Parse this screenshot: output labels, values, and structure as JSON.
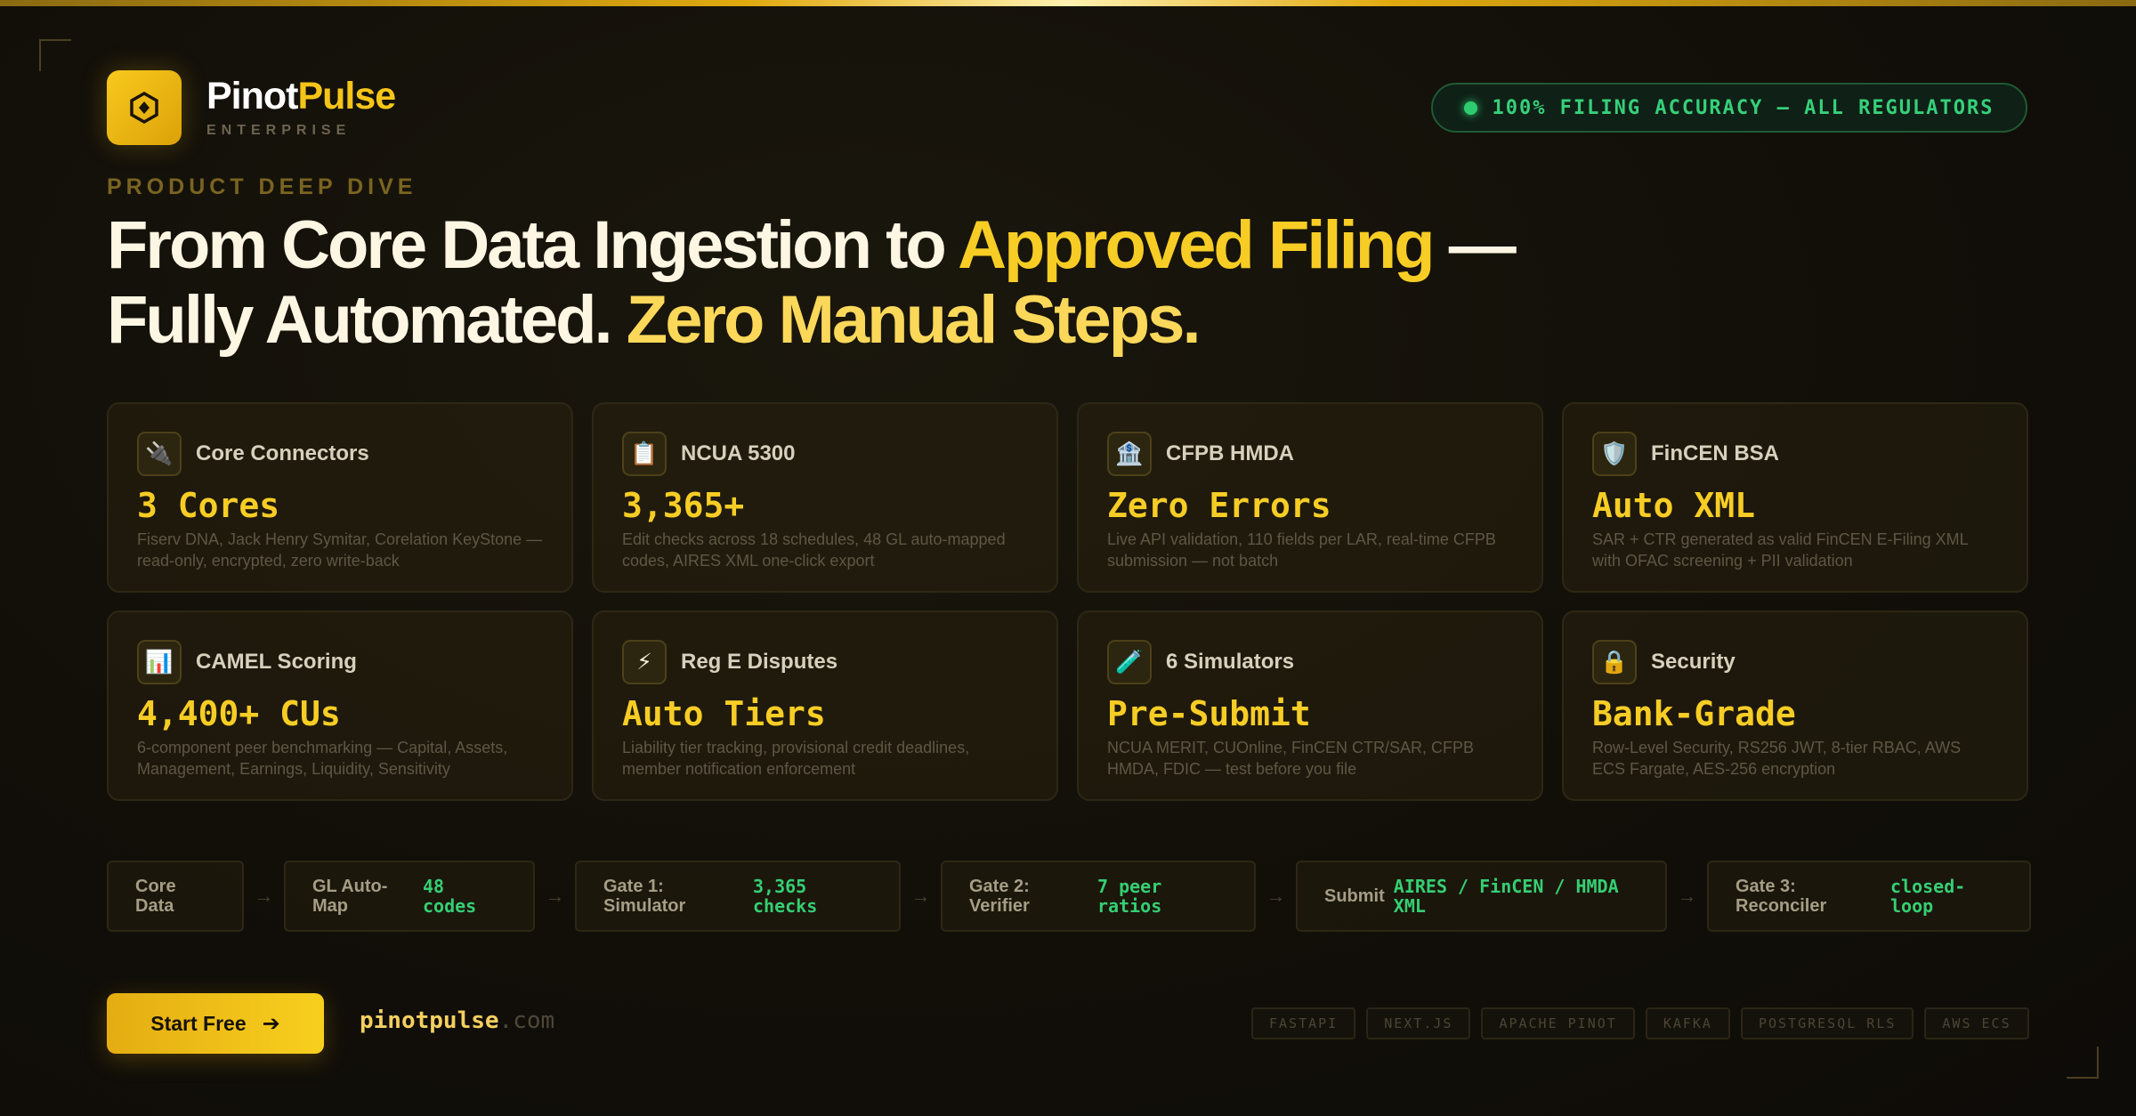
{
  "brand": {
    "name_part1": "Pinot",
    "name_part2": "Pulse",
    "tier": "ENTERPRISE"
  },
  "status_badge": {
    "text": "100% FILING ACCURACY — ALL REGULATORS",
    "color": "#2ecc71"
  },
  "hero": {
    "eyebrow": "PRODUCT DEEP DIVE",
    "line1_a": "From Core Data Ingestion to ",
    "line1_highlight": "Approved Filing",
    "line1_b": " —",
    "line2_a": "Fully Automated. ",
    "line2_highlight": "Zero Manual Steps."
  },
  "cards": [
    {
      "icon": "plug-icon",
      "glyph": "🔌",
      "title": "Core Connectors",
      "value": "3 Cores",
      "desc": "Fiserv DNA, Jack Henry Symitar, Corelation KeyStone — read-only, encrypted, zero write-back"
    },
    {
      "icon": "clipboard-icon",
      "glyph": "📋",
      "title": "NCUA 5300",
      "value": "3,365+",
      "desc": "Edit checks across 18 schedules, 48 GL auto-mapped codes, AIRES XML one-click export"
    },
    {
      "icon": "bank-icon",
      "glyph": "🏦",
      "title": "CFPB HMDA",
      "value": "Zero Errors",
      "desc": "Live API validation, 110 fields per LAR, real-time CFPB submission — not batch"
    },
    {
      "icon": "shield-icon",
      "glyph": "🛡️",
      "title": "FinCEN BSA",
      "value": "Auto XML",
      "desc": "SAR + CTR generated as valid FinCEN E-Filing XML with OFAC screening + PII validation"
    },
    {
      "icon": "bar-chart-icon",
      "glyph": "📊",
      "title": "CAMEL Scoring",
      "value": "4,400+ CUs",
      "desc": "6-component peer benchmarking — Capital, Assets, Management, Earnings, Liquidity, Sensitivity"
    },
    {
      "icon": "lightning-icon",
      "glyph": "⚡",
      "title": "Reg E Disputes",
      "value": "Auto Tiers",
      "desc": "Liability tier tracking, provisional credit deadlines, member notification enforcement"
    },
    {
      "icon": "test-tube-icon",
      "glyph": "🧪",
      "title": "6 Simulators",
      "value": "Pre-Submit",
      "desc": "NCUA MERIT, CUOnline, FinCEN CTR/SAR, CFPB HMDA, FDIC — test before you file"
    },
    {
      "icon": "lock-icon",
      "glyph": "🔒",
      "title": "Security",
      "value": "Bank-Grade",
      "desc": "Row-Level Security, RS256 JWT, 8-tier RBAC, AWS ECS Fargate, AES-256 encryption"
    }
  ],
  "pipeline": [
    {
      "label": "Core Data",
      "value": ""
    },
    {
      "label": "GL Auto-Map",
      "value": "48 codes"
    },
    {
      "label": "Gate 1: Simulator",
      "value": "3,365 checks"
    },
    {
      "label": "Gate 2: Verifier",
      "value": "7 peer ratios"
    },
    {
      "label": "Submit",
      "value": "AIRES / FinCEN / HMDA XML"
    },
    {
      "label": "Gate 3: Reconciler",
      "value": "closed-loop"
    }
  ],
  "pipeline_arrow": "→",
  "cta": {
    "label": "Start Free",
    "arrow": "➔"
  },
  "url": {
    "domain": "pinotpulse",
    "tld": ".com"
  },
  "tech_stack": [
    "FASTAPI",
    "NEXT.JS",
    "APACHE PINOT",
    "KAFKA",
    "POSTGRESQL RLS",
    "AWS ECS"
  ],
  "colors": {
    "accent": "#f7cd25",
    "success": "#35cf73",
    "background": "#120f09"
  }
}
